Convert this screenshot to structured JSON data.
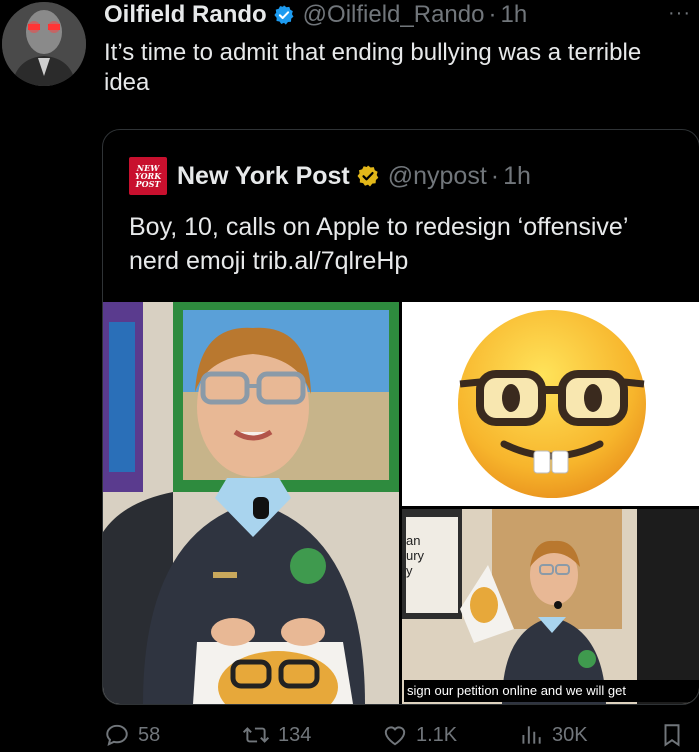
{
  "tweet": {
    "author_name": "Oilfield Rando",
    "handle": "@Oilfield_Rando",
    "separator": "·",
    "time": "1h",
    "more_label": "···",
    "text": "It’s time to admit that ending bullying was a terrible idea"
  },
  "quoted": {
    "logo_lines": [
      "NEW",
      "YORK",
      "POST"
    ],
    "author_name": "New York Post",
    "handle": "@nypost",
    "separator": "·",
    "time": "1h",
    "text": "Boy, 10, calls on Apple to redesign ‘offensive’ nerd emoji trib.al/7qlreHp",
    "video_caption": "sign our petition online and we will get",
    "board_text": [
      "an",
      "ury",
      "y"
    ]
  },
  "actions": {
    "replies": "58",
    "reposts": "134",
    "likes": "1.1K",
    "views": "30K"
  },
  "colors": {
    "background": "#000000",
    "text": "#e7e9ea",
    "muted": "#71767b",
    "verified_blue": "#1d9bf0",
    "verified_gold": "#e2b719",
    "nyp_red": "#c8102e"
  },
  "icons": [
    "verified-badge-icon",
    "reply-icon",
    "repost-icon",
    "like-icon",
    "views-icon",
    "bookmark-icon"
  ]
}
